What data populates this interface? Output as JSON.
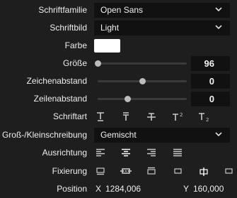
{
  "font_family": {
    "label": "Schriftfamilie",
    "value": "Open Sans"
  },
  "font_style": {
    "label": "Schriftbild",
    "value": "Light"
  },
  "color": {
    "label": "Farbe",
    "value": "#ffffff"
  },
  "size": {
    "label": "Größe",
    "value": "96",
    "level": 0.0
  },
  "letter_spacing": {
    "label": "Zeichenabstand",
    "value": "0",
    "level": 0.5
  },
  "line_spacing": {
    "label": "Zeilenabstand",
    "value": "0",
    "level": 0.33
  },
  "font_type": {
    "label": "Schriftart",
    "icons": [
      "underline-t-icon",
      "overline-t-icon",
      "strikethrough-t-icon",
      "superscript-t-icon",
      "subscript-t-icon"
    ]
  },
  "case": {
    "label": "Groß-/Kleinschreibung",
    "value": "Gemischt"
  },
  "alignment": {
    "label": "Ausrichtung",
    "icons": [
      "align-left-icon",
      "align-center-icon",
      "align-right-icon",
      "align-justify-icon"
    ]
  },
  "anchor": {
    "label": "Fixierung",
    "icons": [
      "anchor-top-icon",
      "anchor-middle-icon",
      "anchor-bottom-icon",
      "anchor-left-icon",
      "anchor-center-icon",
      "anchor-right-icon"
    ]
  },
  "position": {
    "label": "Position",
    "x_label": "X",
    "x_value": "1284,006",
    "y_label": "Y",
    "y_value": "160,000"
  }
}
